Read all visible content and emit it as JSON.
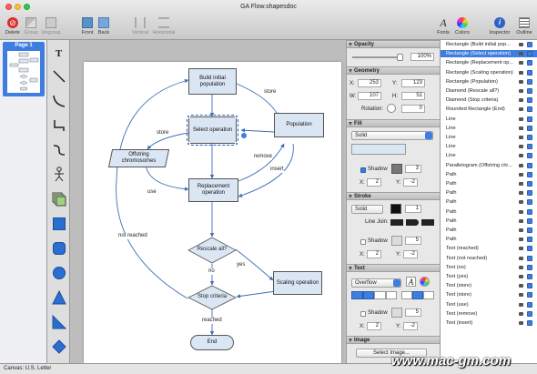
{
  "window": {
    "title": "GA Flow.shapesdoc"
  },
  "toolbar": {
    "delete": "Delete",
    "group": "Group",
    "ungroup": "Ungroup",
    "front": "Front",
    "back": "Back",
    "vertical": "Vertical",
    "horizontal": "Horizontal",
    "fonts": "Fonts",
    "colors": "Colors",
    "inspector": "Inspector",
    "outline": "Outline"
  },
  "pages": {
    "page1": "Page 1"
  },
  "diagram": {
    "build": "Build initial population",
    "select": "Select operation",
    "population": "Population",
    "offspring": "Offstring chromosomes",
    "replacement": "Replacement operation",
    "rescale": "Rescale all?",
    "scaling": "Scaling operation",
    "stop": "Stop criteria",
    "end": "End",
    "lbl_store1": "store",
    "lbl_store2": "store",
    "lbl_remove": "remove",
    "lbl_insert": "insert",
    "lbl_use": "use",
    "lbl_notreached": "not reached",
    "lbl_yes": "yes",
    "lbl_no": "no",
    "lbl_reached": "reached"
  },
  "inspector": {
    "opacity": {
      "title": "Opacity",
      "value": "100%"
    },
    "geometry": {
      "title": "Geometry",
      "x_label": "X:",
      "x": "253",
      "y_label": "Y:",
      "y": "123",
      "w_label": "W:",
      "w": "107",
      "h_label": "H:",
      "h": "51",
      "rotation_label": "Rotation:",
      "rotation": "0"
    },
    "fill": {
      "title": "Fill",
      "mode": "Solid",
      "shadow": "Shadow",
      "shadow_val": "3",
      "x_label": "X:",
      "x": "2",
      "y_label": "Y:",
      "y": "-2"
    },
    "stroke": {
      "title": "Stroke",
      "mode": "Solid",
      "width": "1",
      "linejoin": "Line Join:",
      "shadow": "Shadow",
      "shadow_val": "5",
      "x_label": "X:",
      "x": "2",
      "y_label": "Y:",
      "y": "-2"
    },
    "text": {
      "title": "Text",
      "overflow": "Overflow",
      "shadow": "Shadow",
      "shadow_val": "5",
      "x_label": "X:",
      "x": "2",
      "y_label": "Y:",
      "y": "-2"
    },
    "image": {
      "title": "Image",
      "select": "Select Image..."
    }
  },
  "outline": {
    "items": [
      "Rectangle (Build initial pop...",
      "Rectangle (Select operation)",
      "Rectangle (Replacement op...",
      "Rectangle (Scaling operation)",
      "Rectangle (Population)",
      "Diamond (Rescale all?)",
      "Diamond (Stop criteria)",
      "Rounded Rectangle (End)",
      "Line",
      "Line",
      "Line",
      "Line",
      "Line",
      "Parallelogram (Offstring chr...",
      "Path",
      "Path",
      "Path",
      "Path",
      "Path",
      "Path",
      "Path",
      "Path",
      "Text (reached)",
      "Text (not reached)",
      "Text (no)",
      "Text (yes)",
      "Text (store)",
      "Text (store)",
      "Text (use)",
      "Text (remove)",
      "Text (insert)"
    ],
    "selected_index": 1
  },
  "status": {
    "canvas": "Canvas: U.S. Letter"
  },
  "watermark": "www.mac-gm.com",
  "colors": {
    "selection": "#3f7de0",
    "shape_fill": "#dbe6f4",
    "delete_red": "#d9302c"
  }
}
